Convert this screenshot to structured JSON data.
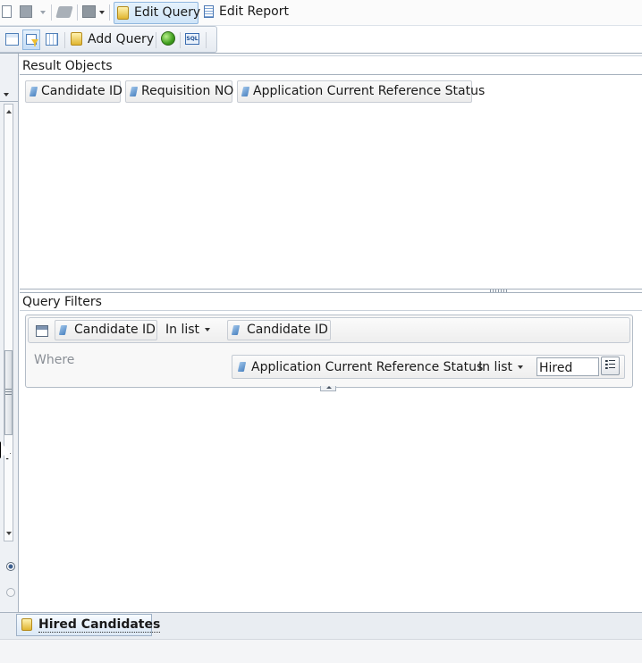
{
  "toolbar": {
    "edit_query_label": "Edit Query",
    "edit_report_label": "Edit Report",
    "add_query_label": "Add Query",
    "sql_icon_label": "SQL"
  },
  "result_objects": {
    "title": "Result Objects",
    "items": [
      {
        "label": "Candidate ID"
      },
      {
        "label": "Requisition NO"
      },
      {
        "label": "Application Current Reference Status"
      }
    ]
  },
  "query_filters": {
    "title": "Query Filters",
    "filter1": {
      "object": "Candidate ID",
      "operator": "In list",
      "operand": "Candidate ID"
    },
    "where_label": "Where",
    "filter2": {
      "object": "Application Current Reference Status",
      "operator": "In list",
      "value": "Hired"
    }
  },
  "tabs": {
    "active": "Hired Candidates"
  },
  "colors": {
    "accent_blue": "#4a82c0",
    "toolbar_bg": "#e6ebf1",
    "selected_bg": "#cfe4f8"
  }
}
